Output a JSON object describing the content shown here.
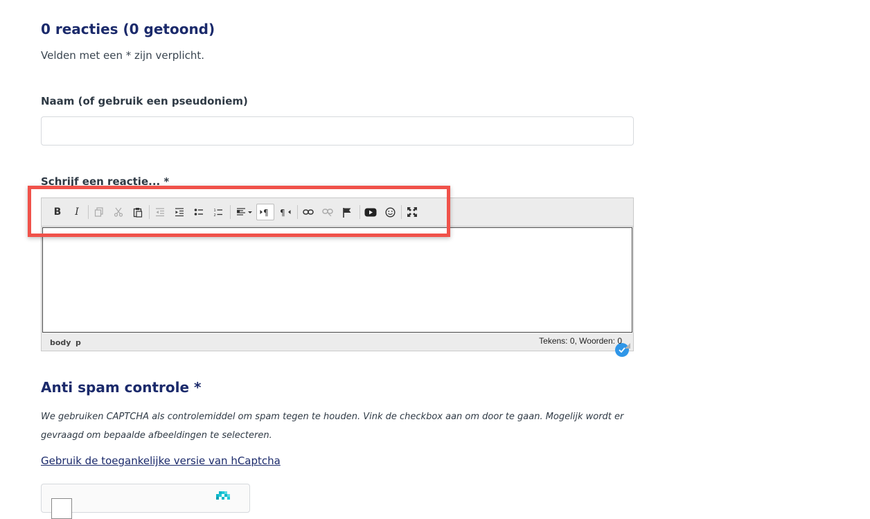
{
  "comments": {
    "heading": "0 reacties (0 getoond)",
    "required_note": "Velden met een * zijn verplicht."
  },
  "name_field": {
    "label": "Naam (of gebruik een pseudoniem)",
    "value": "",
    "placeholder": ""
  },
  "comment_field": {
    "label": "Schrijf een reactie... *"
  },
  "editor": {
    "toolbar_icons": [
      "bold-icon",
      "italic-icon",
      "copy-icon",
      "cut-icon",
      "paste-icon",
      "outdent-icon",
      "indent-icon",
      "bullet-list-icon",
      "numbered-list-icon",
      "align-dropdown-icon",
      "ltr-icon",
      "rtl-icon",
      "link-icon",
      "unlink-icon",
      "anchor-flag-icon",
      "youtube-icon",
      "emoji-icon",
      "fullscreen-icon"
    ],
    "bold": "B",
    "italic": "I",
    "path": [
      "body",
      "p"
    ],
    "count": "Tekens: 0, Woorden: 0"
  },
  "anti_spam": {
    "title": "Anti spam controle *",
    "description": "We gebruiken CAPTCHA als controlemiddel om spam tegen te houden. Vink de checkbox aan om door te gaan. Mogelijk wordt er gevraagd om bepaalde afbeeldingen te selecteren.",
    "accessible_link": "Gebruik de toegankelijke versie van hCaptcha"
  },
  "colors": {
    "heading": "#1b2a6b",
    "highlight": "#f0524a",
    "check_badge": "#2f96e8"
  }
}
